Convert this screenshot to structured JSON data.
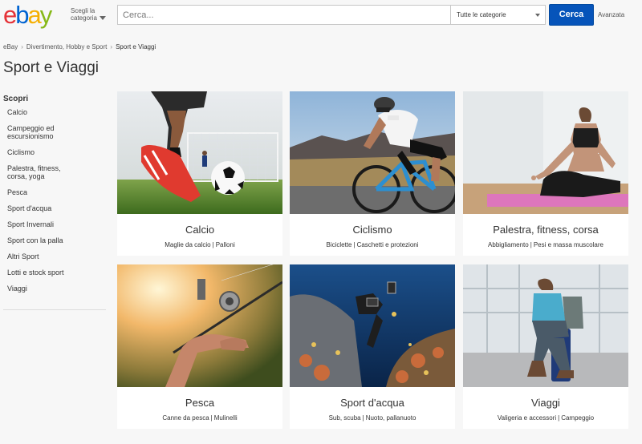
{
  "header": {
    "logo_letters": [
      {
        "char": "e",
        "color": "#e53238"
      },
      {
        "char": "b",
        "color": "#0064d2"
      },
      {
        "char": "a",
        "color": "#f5af02"
      },
      {
        "char": "y",
        "color": "#86b817"
      }
    ],
    "category_picker_label": "Scegli la categoria",
    "search_placeholder": "Cerca...",
    "category_select_value": "Tutte le categorie",
    "search_button_label": "Cerca",
    "advanced_label": "Avanzata",
    "search_button_color": "#0654ba"
  },
  "breadcrumb": {
    "items": [
      "eBay",
      "Divertimento, Hobby e Sport",
      "Sport e Viaggi"
    ],
    "separator": "›"
  },
  "page_title": "Sport e Viaggi",
  "sidebar": {
    "heading": "Scopri",
    "items": [
      "Calcio",
      "Campeggio ed escursionismo",
      "Ciclismo",
      "Palestra, fitness, corsa, yoga",
      "Pesca",
      "Sport d'acqua",
      "Sport Invernali",
      "Sport con la palla",
      "Altri Sport",
      "Lotti e stock sport",
      "Viaggi"
    ]
  },
  "cards": [
    {
      "title": "Calcio",
      "links": [
        "Maglie da calcio",
        "Palloni"
      ],
      "image": "soccer-photo"
    },
    {
      "title": "Ciclismo",
      "links": [
        "Biciclette",
        "Caschetti e protezioni"
      ],
      "image": "cycling-photo"
    },
    {
      "title": "Palestra, fitness, corsa",
      "links": [
        "Abbigliamento",
        "Pesi e massa muscolare"
      ],
      "image": "yoga-photo"
    },
    {
      "title": "Pesca",
      "links": [
        "Canne da pesca",
        "Mulinelli"
      ],
      "image": "fishing-photo"
    },
    {
      "title": "Sport d'acqua",
      "links": [
        "Sub, scuba",
        "Nuoto, pallanuoto"
      ],
      "image": "diving-photo"
    },
    {
      "title": "Viaggi",
      "links": [
        "Valigeria e accessori",
        "Campeggio"
      ],
      "image": "travel-photo"
    }
  ]
}
